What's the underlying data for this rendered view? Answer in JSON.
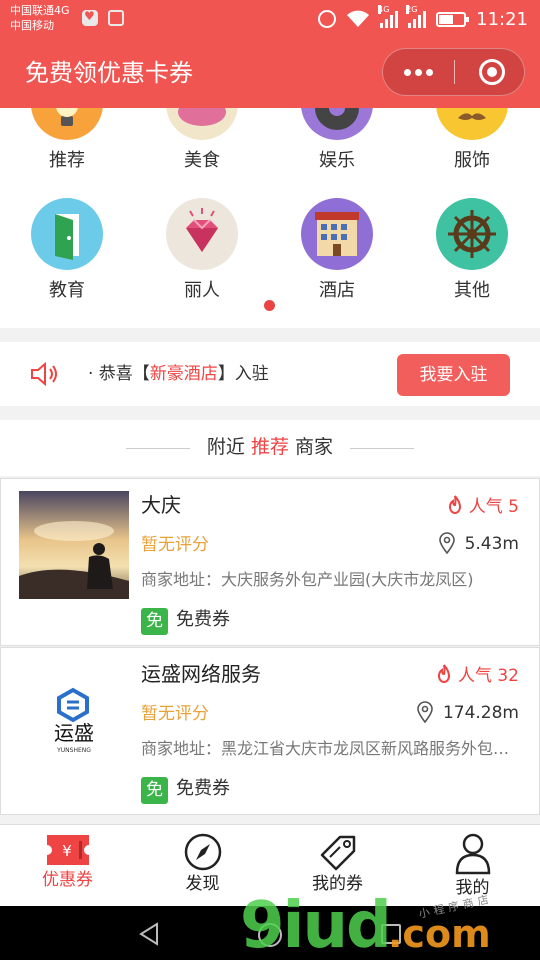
{
  "status_bar": {
    "carrier_1": "中国联通4G",
    "carrier_2": "中国移动",
    "net_1": "4G",
    "net_2": "2G",
    "time": "11:21"
  },
  "nav": {
    "title": "免费领优惠卡券"
  },
  "categories": [
    {
      "label": "推荐",
      "color": "#f7a23b"
    },
    {
      "label": "美食",
      "color": "#f1e6c9"
    },
    {
      "label": "娱乐",
      "color": "#9b78d8"
    },
    {
      "label": "服饰",
      "color": "#f8c630"
    },
    {
      "label": "教育",
      "color": "#6ccbe9"
    },
    {
      "label": "丽人",
      "color": "#ece6dc"
    },
    {
      "label": "酒店",
      "color": "#8f6fd6"
    },
    {
      "label": "其他",
      "color": "#3fc2a2"
    }
  ],
  "notice": {
    "prefix": "· 恭喜【",
    "highlight": "新豪酒店",
    "suffix": "】入驻",
    "button": "我要入驻"
  },
  "nearby": {
    "title_pre": "附近",
    "title_hl": "推荐",
    "title_post": "商家"
  },
  "merchants": [
    {
      "name": "大庆",
      "popularity": "人气 5",
      "rating": "暂无评分",
      "distance": "5.43m",
      "address": "商家地址：大庆服务外包产业园(大庆市龙凤区)",
      "coupon_tag": "免",
      "coupon": "免费券"
    },
    {
      "name": "运盛网络服务",
      "popularity": "人气 32",
      "rating": "暂无评分",
      "distance": "174.28m",
      "address": "商家地址：黑龙江省大庆市龙凤区新风路服务外包产业园",
      "coupon_tag": "免",
      "coupon": "免费券",
      "logo_text": "运盛",
      "logo_sub": "YUNSHENG"
    }
  ],
  "tabs": [
    {
      "label": "优惠券",
      "active": true,
      "icon": "ticket-icon"
    },
    {
      "label": "发现",
      "active": false,
      "icon": "compass-icon"
    },
    {
      "label": "我的券",
      "active": false,
      "icon": "tag-icon"
    },
    {
      "label": "我的",
      "active": false,
      "icon": "user-icon"
    }
  ],
  "watermark": {
    "brand": "9iud",
    "suffix": ".com",
    "tag": "小程序商店"
  },
  "colors": {
    "brand_red": "#f05552",
    "accent_red": "#e44444",
    "rating_orange": "#e8a23a",
    "coupon_green": "#3bb54a"
  }
}
